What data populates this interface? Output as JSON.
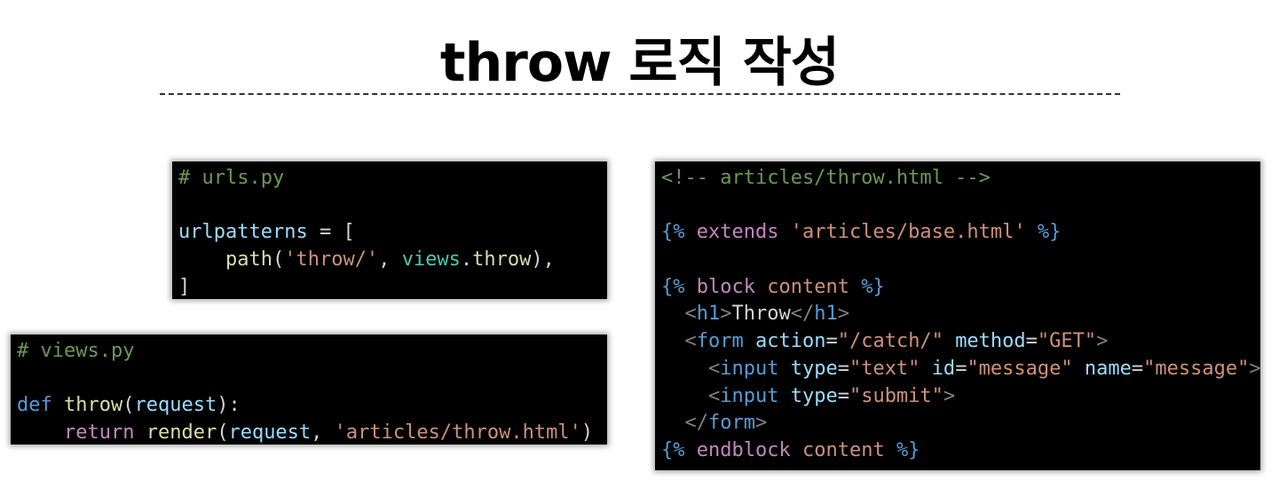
{
  "title": "throw 로직 작성",
  "urls_code": {
    "comment": "# urls.py",
    "var": "urlpatterns",
    "eq": " = [",
    "indent": "    ",
    "fn": "path",
    "open": "(",
    "route": "'throw/'",
    "comma": ", ",
    "module": "views",
    "dot": ".",
    "view": "throw",
    "close": "),",
    "end": "]"
  },
  "views_code": {
    "comment": "# views.py",
    "def": "def",
    "space": " ",
    "fn": "throw",
    "open": "(",
    "param": "request",
    "close": "):",
    "indent": "    ",
    "ret": "return",
    "render": "render",
    "comma": ", ",
    "template": "'articles/throw.html'",
    "rclose": ")"
  },
  "template_code": {
    "comment": "<!-- articles/throw.html -->",
    "tpl_open": "{%",
    "tpl_close": "%}",
    "extends": "extends",
    "base": "'articles/base.html'",
    "block": "block",
    "endblock": "endblock",
    "content": "content",
    "lt": "<",
    "gt": ">",
    "lts": "</",
    "h1": "h1",
    "h1_text": "Throw",
    "form": "form",
    "input": "input",
    "action": "action",
    "action_val": "\"/catch/\"",
    "method": "method",
    "method_val": "\"GET\"",
    "type": "type",
    "type_text": "\"text\"",
    "id": "id",
    "id_val": "\"message\"",
    "name": "name",
    "name_val": "\"message\"",
    "type_submit": "\"submit\"",
    "eq": "="
  }
}
